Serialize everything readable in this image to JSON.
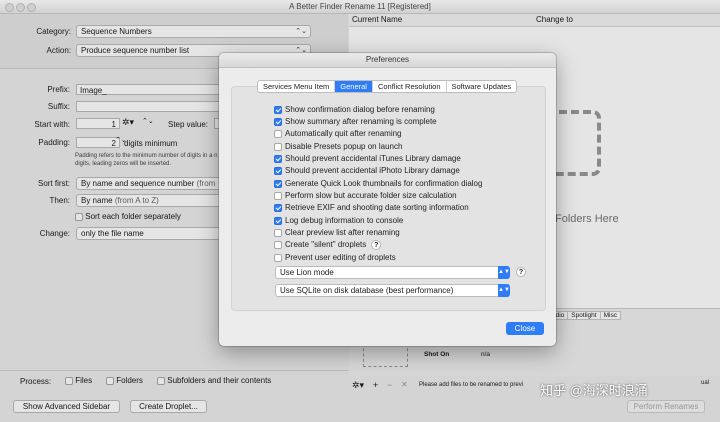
{
  "window": {
    "title": "A Better Finder Rename 11 [Registered]"
  },
  "left": {
    "category_label": "Category:",
    "category_value": "Sequence Numbers",
    "action_label": "Action:",
    "action_value": "Produce sequence number list",
    "prefix_label": "Prefix:",
    "prefix_value": "Image_",
    "suffix_label": "Suffix:",
    "start_label": "Start with:",
    "start_value": "1",
    "step_label": "Step value:",
    "padding_label": "Padding:",
    "padding_value": "2",
    "padding_unit": "digits minimum",
    "padding_note_1": "Padding refers to the minimum number of digits in a n",
    "padding_note_2": "digits, leading zeros will be inserted.",
    "sortfirst_label": "Sort first:",
    "sortfirst_value": "By name and sequence number",
    "sortfirst_hint": "(from",
    "then_label": "Then:",
    "then_value": "By name",
    "then_hint": "(from A to Z)",
    "sort_each_folder": "Sort each folder separately",
    "change_label": "Change:",
    "change_value": "only the file name",
    "process_label": "Process:",
    "process_files": "Files",
    "process_folders": "Folders",
    "process_subfolders": "Subfolders and their contents",
    "show_sidebar_button": "Show Advanced Sidebar",
    "create_droplet_button": "Create Droplet..."
  },
  "right": {
    "col_current": "Current Name",
    "col_change": "Change to",
    "drop_text": "Folders Here",
    "info_tabs": [
      "udio",
      "Spotlight",
      "Misc"
    ],
    "shot_on_label": "Shot On",
    "shot_on_value": "n/a",
    "status_text": "Please add files to be renamed to previ",
    "perform_button": "Perform Renames",
    "perform_hint": "ual"
  },
  "prefs": {
    "title": "Preferences",
    "tabs": [
      "Services Menu Item",
      "General",
      "Conflict Resolution",
      "Software Updates"
    ],
    "selected_tab": "General",
    "options": [
      {
        "label": "Show confirmation dialog before renaming",
        "checked": true
      },
      {
        "label": "Show summary after renaming is complete",
        "checked": true
      },
      {
        "label": "Automatically quit after renaming",
        "checked": false
      },
      {
        "label": "Disable Presets popup on launch",
        "checked": false
      },
      {
        "label": "Should prevent accidental iTunes Library damage",
        "checked": true
      },
      {
        "label": "Should prevent accidental iPhoto Library damage",
        "checked": true
      },
      {
        "label": "Generate Quick Look thumbnails for confirmation dialog",
        "checked": true
      },
      {
        "label": "Perform slow but accurate folder size calculation",
        "checked": false
      },
      {
        "label": "Retrieve EXIF and shooting date sorting information",
        "checked": true
      },
      {
        "label": "Log debug information to console",
        "checked": true
      },
      {
        "label": "Clear preview list after renaming",
        "checked": false
      },
      {
        "label": "Create \"silent\" droplets",
        "checked": false
      },
      {
        "label": "Prevent user editing of droplets",
        "checked": false
      }
    ],
    "mode_select": "Use Lion mode",
    "db_select": "Use SQLite on disk database (best performance)",
    "help_glyph": "?",
    "close_button": "Close"
  },
  "watermark": "知乎 @海深时浪涌",
  "colors": {
    "accent": "#2f7df6",
    "window_bg": "#ececec"
  }
}
